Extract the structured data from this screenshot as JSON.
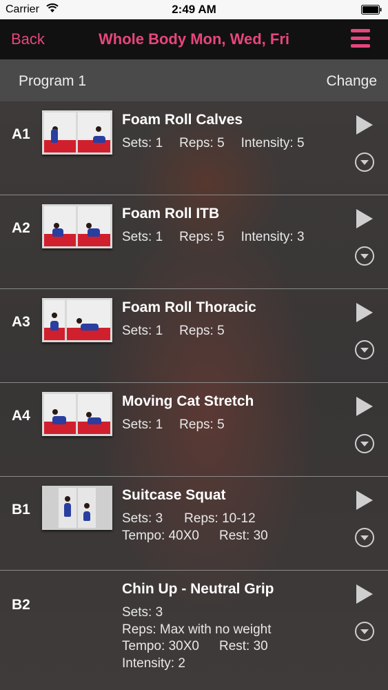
{
  "status": {
    "carrier": "Carrier",
    "time": "2:49 AM"
  },
  "nav": {
    "back": "Back",
    "title": "Whole Body Mon, Wed, Fri"
  },
  "program": {
    "label": "Program 1",
    "change": "Change"
  },
  "colors": {
    "accent": "#e8457d"
  },
  "exercises": [
    {
      "code": "A1",
      "name": "Foam Roll Calves",
      "line1a": "Sets: 1",
      "line1b": "Reps: 5",
      "line1c": "Intensity: 5"
    },
    {
      "code": "A2",
      "name": "Foam Roll ITB",
      "line1a": "Sets: 1",
      "line1b": "Reps: 5",
      "line1c": "Intensity: 3"
    },
    {
      "code": "A3",
      "name": "Foam Roll Thoracic",
      "line1a": "Sets: 1",
      "line1b": "Reps: 5"
    },
    {
      "code": "A4",
      "name": "Moving Cat Stretch",
      "line1a": "Sets: 1",
      "line1b": "Reps: 5"
    },
    {
      "code": "B1",
      "name": "Suitcase Squat",
      "line1a": "Sets: 3",
      "line1b": "Reps: 10-12",
      "line2a": "Tempo: 40X0",
      "line2b": "Rest: 30"
    },
    {
      "code": "B2",
      "name": "Chin Up - Neutral Grip",
      "line1a": "Sets: 3",
      "line2": "Reps: Max with no weight",
      "line3a": "Tempo: 30X0",
      "line3b": "Rest: 30",
      "line4": "Intensity: 2"
    }
  ]
}
